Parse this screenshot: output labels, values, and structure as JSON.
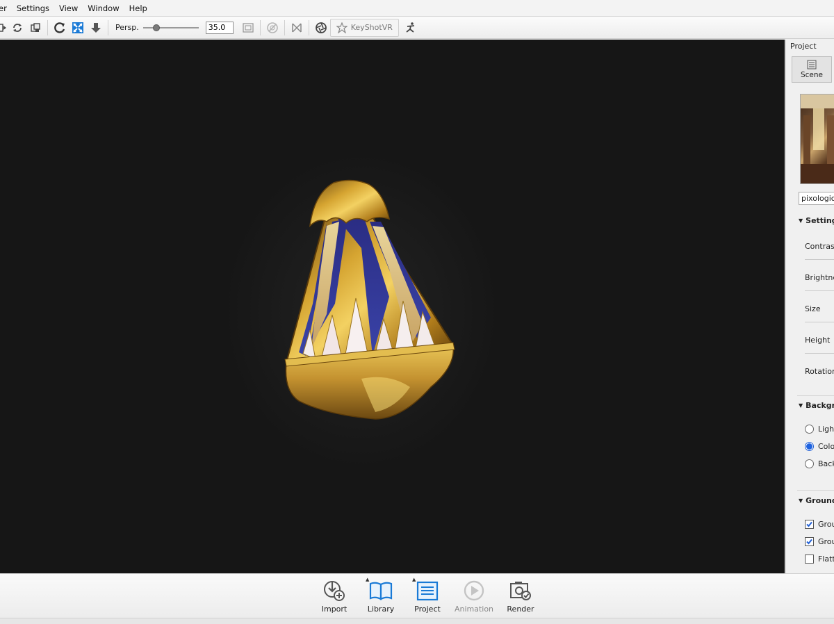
{
  "menu": {
    "items": [
      "er",
      "Settings",
      "View",
      "Window",
      "Help"
    ]
  },
  "toolbar": {
    "persp_label": "Persp.",
    "fov_value": "35.0",
    "fov_slider_fraction": 0.2,
    "vr_label": "KeyShotVR"
  },
  "panel": {
    "title": "Project",
    "scene_tab_label": "Scene",
    "environment_name": "pixologic_",
    "settings_header": "Setting",
    "settings_fields": [
      "Contrast",
      "Brightne",
      "Size",
      "Height",
      "Rotation"
    ],
    "background_header": "Backgr",
    "background_options": [
      {
        "label": "Light",
        "selected": false
      },
      {
        "label": "Colo",
        "selected": true
      },
      {
        "label": "Back",
        "selected": false
      }
    ],
    "ground_header": "Ground",
    "ground_options": [
      {
        "label": "Grou",
        "checked": true
      },
      {
        "label": "Grou",
        "checked": true
      },
      {
        "label": "Flatt",
        "checked": false
      }
    ]
  },
  "bottom": {
    "buttons": [
      {
        "label": "Import",
        "icon": "import-icon",
        "enabled": true
      },
      {
        "label": "Library",
        "icon": "library-book-icon",
        "enabled": true
      },
      {
        "label": "Project",
        "icon": "project-list-icon",
        "enabled": true
      },
      {
        "label": "Animation",
        "icon": "animation-play-icon",
        "enabled": false
      },
      {
        "label": "Render",
        "icon": "render-camera-icon",
        "enabled": true
      }
    ]
  },
  "colors": {
    "viewport_bg": "#161616",
    "accent_blue": "#1a7ad6",
    "selection_blue": "#1f63e0"
  }
}
